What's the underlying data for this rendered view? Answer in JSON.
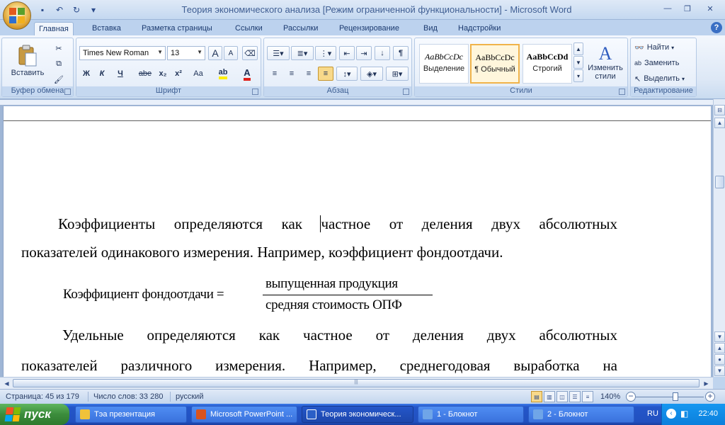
{
  "window": {
    "title": "Теория экономического анализа [Режим ограниченной функциональности] - Microsoft Word"
  },
  "tabs": [
    "Главная",
    "Вставка",
    "Разметка страницы",
    "Ссылки",
    "Рассылки",
    "Рецензирование",
    "Вид",
    "Надстройки"
  ],
  "ribbon": {
    "clipboard": {
      "paste_label": "Вставить",
      "group_label": "Буфер обмена"
    },
    "font": {
      "font_name": "Times New Roman",
      "font_size": "13",
      "group_label": "Шрифт",
      "bold": "Ж",
      "italic": "К",
      "underline": "Ч",
      "strike": "abe",
      "subscript": "x₂",
      "superscript": "x²",
      "case": "Aa",
      "grow": "A",
      "shrink": "A"
    },
    "paragraph": {
      "group_label": "Абзац",
      "pilcrow": "¶"
    },
    "styles": {
      "group_label": "Стили",
      "items": [
        {
          "sample": "AaBbCcDc",
          "name": "Выделение"
        },
        {
          "sample": "AaBbCcDc",
          "name": "¶ Обычный"
        },
        {
          "sample": "AaBbCcDd",
          "name": "Строгий"
        }
      ],
      "change_label_1": "Изменить",
      "change_label_2": "стили"
    },
    "editing": {
      "group_label": "Редактирование",
      "find": "Найти",
      "replace": "Заменить",
      "select": "Выделить"
    }
  },
  "document": {
    "p1_line1": "Коэффициенты определяются как частное от деления двух абсолютных",
    "p1_line2": "показателей одинакового измерения. Например,  коэффициент фондоотдачи.",
    "formula": {
      "lhs": "Коэффициент фондоотдачи =",
      "numerator": "выпущенная продукция",
      "denominator": "средняя стоимость ОПФ"
    },
    "p2_line1": "Удельные определяются как частное от деления двух абсолютных",
    "p2_line2": "показателей различного измерения. Например, среднегодовая выработка на"
  },
  "status": {
    "page": "Страница: 45 из 179",
    "words": "Число слов: 33 280",
    "language": "русский",
    "zoom": "140%"
  },
  "taskbar": {
    "start": "пуск",
    "items": [
      {
        "label": "Тэа презентация",
        "icon_color": "#f0c23a"
      },
      {
        "label": "Microsoft PowerPoint ...",
        "icon_color": "#d9531e"
      },
      {
        "label": "Теория экономическ...",
        "icon_color": "#2b5fc7"
      },
      {
        "label": "1 - Блокнот",
        "icon_color": "#6fa5e8"
      },
      {
        "label": "2 - Блокнот",
        "icon_color": "#6fa5e8"
      }
    ],
    "language": "RU",
    "clock": "22:40"
  }
}
